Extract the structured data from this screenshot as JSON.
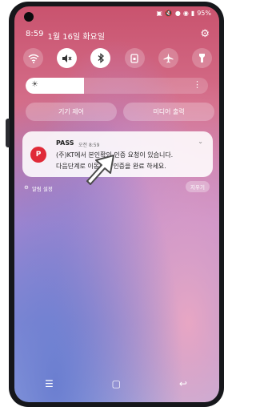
{
  "status_bar": {
    "icons": [
      "signal-icon",
      "volume-icon",
      "location-icon",
      "wifi-icon",
      "signal-bars-icon"
    ],
    "battery": "95%"
  },
  "header": {
    "time": "8:59",
    "date": "1월 16일 화요일"
  },
  "quick_settings": [
    {
      "name": "wifi-toggle",
      "icon": "wifi-icon",
      "on": false
    },
    {
      "name": "sound-toggle",
      "icon": "mute-icon",
      "on": true
    },
    {
      "name": "bluetooth-toggle",
      "icon": "bluetooth-icon",
      "on": true
    },
    {
      "name": "rotation-toggle",
      "icon": "rotation-lock-icon",
      "on": false
    },
    {
      "name": "airplane-toggle",
      "icon": "airplane-icon",
      "on": false
    },
    {
      "name": "flashlight-toggle",
      "icon": "flashlight-icon",
      "on": false
    }
  ],
  "brightness": {
    "level": 0.32
  },
  "controls": {
    "device_control": "기기 제어",
    "media_output": "미디어 출력"
  },
  "notification": {
    "app_icon_letter": "P",
    "app_name": "PASS",
    "time": "오전 8:59",
    "line1": "(주)KT에서 본인확인 인증 요청이 있습니다.",
    "line2": "다음단계로 이동하여  인증을 완료 하세요."
  },
  "notification_footer": {
    "settings_label": "알림 설정",
    "clear_label": "지우기"
  }
}
